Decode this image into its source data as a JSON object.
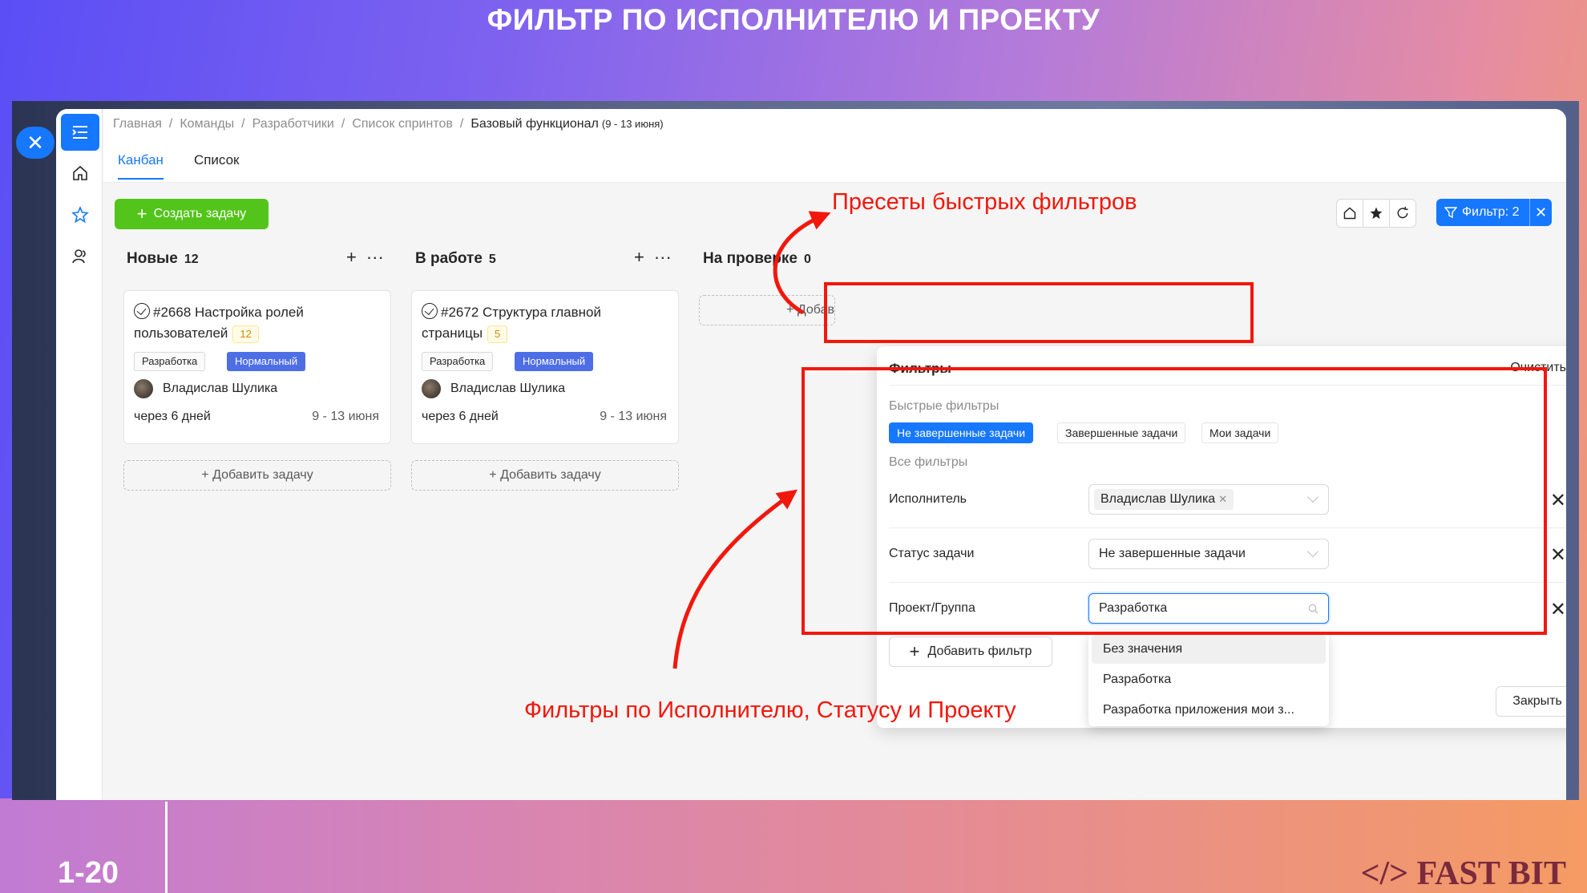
{
  "slide": {
    "title": "ФИЛЬТР ПО ИСПОЛНИТЕЛЮ И ПРОЕКТУ",
    "number": "1-20",
    "brand": "</> FAST BIT"
  },
  "breadcrumb": {
    "items": [
      "Главная",
      "Команды",
      "Разработчики",
      "Список спринтов"
    ],
    "separator": "/",
    "current": "Базовый функционал",
    "current_sub": "(9 - 13 июня)"
  },
  "tabs": [
    {
      "label": "Канбан",
      "active": true
    },
    {
      "label": "Список",
      "active": false
    }
  ],
  "toolbar": {
    "create_label": "Создать задачу",
    "filter_label": "Фильтр: 2"
  },
  "columns": [
    {
      "title": "Новые",
      "count": "12"
    },
    {
      "title": "В работе",
      "count": "5"
    },
    {
      "title": "На проверке",
      "count": "0"
    }
  ],
  "cards": [
    {
      "id": "#2668",
      "title": "Настройка ролей пользователей",
      "badge": "12",
      "tags": [
        "Разработка",
        "Нормальный"
      ],
      "assignee": "Владислав Шулика",
      "due": "через 6 дней",
      "dates": "9 - 13 июня"
    },
    {
      "id": "#2672",
      "title": "Структура главной страницы",
      "badge": "5",
      "tags": [
        "Разработка",
        "Нормальный"
      ],
      "assignee": "Владислав Шулика",
      "due": "через 6 дней",
      "dates": "9 - 13 июня"
    }
  ],
  "add_task_label": "+ Добавить задачу",
  "add_task_partial": "+ Добав",
  "filters_panel": {
    "title": "Фильтры",
    "clear_label": "Очистить",
    "quick_label": "Быстрые фильтры",
    "quick": [
      {
        "label": "Не завершенные задачи",
        "active": true
      },
      {
        "label": "Завершенные задачи",
        "active": false
      },
      {
        "label": "Мои задачи",
        "active": false
      }
    ],
    "all_label": "Все фильтры",
    "rows": [
      {
        "label": "Исполнитель",
        "value": "Владислав Шулика"
      },
      {
        "label": "Статус задачи",
        "value": "Не завершенные задачи"
      },
      {
        "label": "Проект/Группа",
        "value": "Разработка"
      }
    ],
    "add_filter_label": "Добавить фильтр",
    "close_label": "Закрыть",
    "dropdown_options": [
      "Без значения",
      "Разработка",
      "Разработка приложения мои з..."
    ]
  },
  "annotations": {
    "presets": "Пресеты быстрых фильтров",
    "filters": "Фильтры по Исполнителю, Статусу и Проекту"
  },
  "colors": {
    "accent": "#1677ff",
    "create": "#52c41a",
    "priority_tag": "#4e6ee5",
    "annotation": "#f2170c"
  }
}
